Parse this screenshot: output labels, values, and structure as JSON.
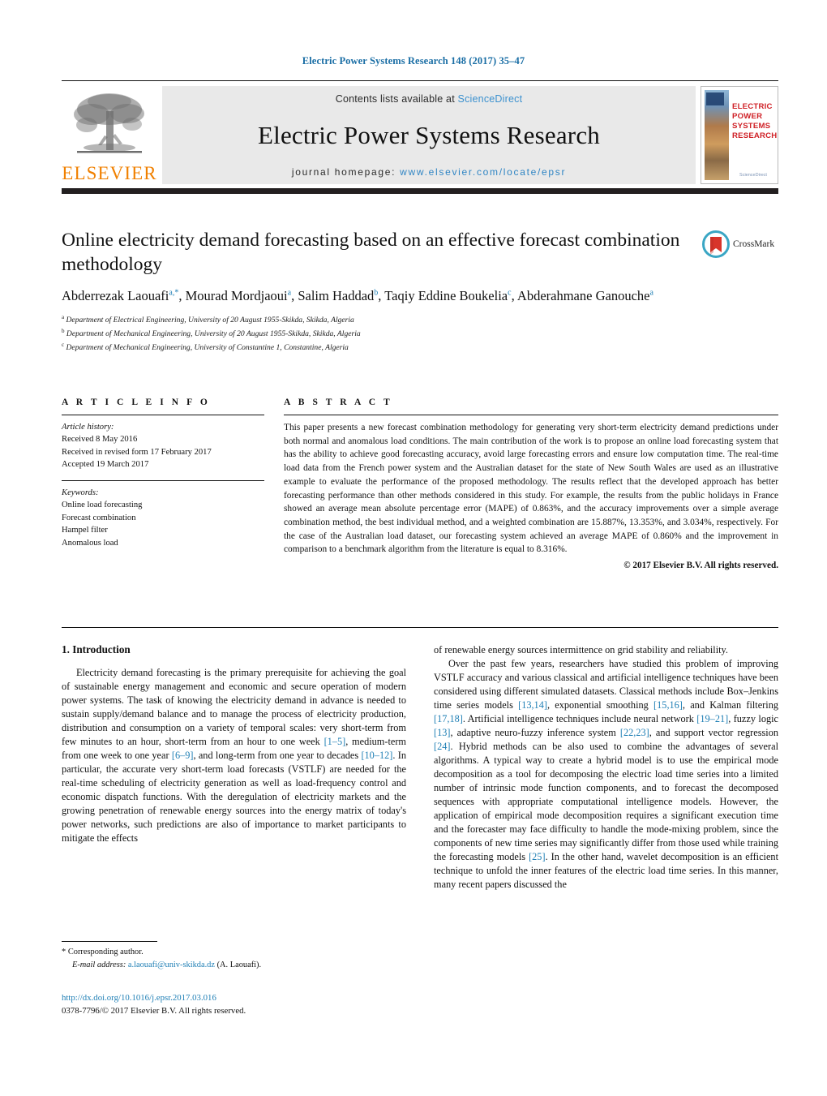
{
  "running_head": "Electric Power Systems Research 148 (2017) 35–47",
  "masthead": {
    "contents_prefix": "Contents lists available at ",
    "sciencedirect": "ScienceDirect",
    "journal_title": "Electric Power Systems Research",
    "homepage_prefix": "journal homepage: ",
    "homepage_url": "www.elsevier.com/locate/epsr",
    "publisher": "ELSEVIER",
    "cover_title": "ELECTRIC POWER SYSTEMS RESEARCH",
    "cover_footer": "ScienceDirect",
    "accent_blue": "#3c91cf",
    "publisher_orange": "#f08000",
    "cover_red": "#cf2026"
  },
  "article": {
    "title": "Online electricity demand forecasting based on an effective forecast combination methodology",
    "authors_html": "Abderrezak Laouafi<sup>a,*</sup>, Mourad Mordjaoui<sup>a</sup>, Salim Haddad<sup>b</sup>, Taqiy Eddine Boukelia<sup>c</sup>, Abderahmane Ganouche<sup>a</sup>",
    "affiliations": [
      "Department of Electrical Engineering, University of 20 August 1955-Skikda, Skikda, Algeria",
      "Department of Mechanical Engineering, University of 20 August 1955-Skikda, Skikda, Algeria",
      "Department of Mechanical Engineering, University of Constantine 1, Constantine, Algeria"
    ],
    "affiliation_marks": [
      "a",
      "b",
      "c"
    ],
    "crossmark_label": "CrossMark"
  },
  "article_info": {
    "heading": "A R T I C L E   I N F O",
    "history_label": "Article history:",
    "history": [
      "Received 8 May 2016",
      "Received in revised form 17 February 2017",
      "Accepted 19 March 2017"
    ],
    "keywords_label": "Keywords:",
    "keywords": [
      "Online load forecasting",
      "Forecast combination",
      "Hampel filter",
      "Anomalous load"
    ]
  },
  "abstract": {
    "heading": "A B S T R A C T",
    "text": "This paper presents a new forecast combination methodology for generating very short-term electricity demand predictions under both normal and anomalous load conditions. The main contribution of the work is to propose an online load forecasting system that has the ability to achieve good forecasting accuracy, avoid large forecasting errors and ensure low computation time. The real-time load data from the French power system and the Australian dataset for the state of New South Wales are used as an illustrative example to evaluate the performance of the proposed methodology. The results reflect that the developed approach has better forecasting performance than other methods considered in this study. For example, the results from the public holidays in France showed an average mean absolute percentage error (MAPE) of 0.863%, and the accuracy improvements over a simple average combination method, the best individual method, and a weighted combination are 15.887%, 13.353%, and 3.034%, respectively. For the case of the Australian load dataset, our forecasting system achieved an average MAPE of 0.860% and the improvement in comparison to a benchmark algorithm from the literature is equal to 8.316%.",
    "copyright": "© 2017 Elsevier B.V. All rights reserved."
  },
  "introduction": {
    "number_title": "1.  Introduction",
    "left_para_1_a": "Electricity demand forecasting is the primary prerequisite for achieving the goal of sustainable energy management and economic and secure operation of modern power systems. The task of knowing the electricity demand in advance is needed to sustain supply/demand balance and to manage the process of electricity production, distribution and consumption on a variety of temporal scales: very short-term from few minutes to an hour, short-term from an hour to one week ",
    "cite_1_5": "[1–5]",
    "left_para_1_b": ", medium-term from one week to one year ",
    "cite_6_9": "[6–9]",
    "left_para_1_c": ", and long-term from one year to decades ",
    "cite_10_12": "[10–12]",
    "left_para_1_d": ". In particular, the accurate very short-term load forecasts (VSTLF) are needed for the real-time scheduling of electricity generation as well as load-frequency control and economic dispatch functions. With the deregulation of electricity markets and the growing penetration of renewable energy sources into the energy matrix of today's power networks, such predictions are also of importance to market participants to mitigate the effects",
    "right_para_1_cont": "of renewable energy sources intermittence on grid stability and reliability.",
    "right_para_2_a": "Over the past few years, researchers have studied this problem of improving VSTLF accuracy and various classical and artificial intelligence techniques have been considered using different simulated datasets. Classical methods include Box–Jenkins time series models ",
    "cite_13_14": "[13,14]",
    "right_para_2_b": ", exponential smoothing ",
    "cite_15_16": "[15,16]",
    "right_para_2_c": ", and Kalman filtering ",
    "cite_17_18": "[17,18]",
    "right_para_2_d": ". Artificial intelligence techniques include neural network ",
    "cite_19_21": "[19–21]",
    "right_para_2_e": ", fuzzy logic ",
    "cite_13": "[13]",
    "right_para_2_f": ", adaptive neuro-fuzzy inference system ",
    "cite_22_23": "[22,23]",
    "right_para_2_g": ", and support vector regression ",
    "cite_24": "[24]",
    "right_para_2_h": ". Hybrid methods can be also used to combine the advantages of several algorithms. A typical way to create a hybrid model is to use the empirical mode decomposition as a tool for decomposing the electric load time series into a limited number of intrinsic mode function components, and to forecast the decomposed sequences with appropriate computational intelligence models. However, the application of empirical mode decomposition requires a significant execution time and the forecaster may face difficulty to handle the mode-mixing problem, since the components of new time series may significantly differ from those used while training the forecasting models ",
    "cite_25": "[25]",
    "right_para_2_i": ". In the other hand, wavelet decomposition is an efficient technique to unfold the inner features of the electric load time series. In this manner, many recent papers discussed the"
  },
  "footer": {
    "corresponding_marker": "*",
    "corresponding_label": "Corresponding author.",
    "email_label": "E-mail address:",
    "email": "a.laouafi@univ-skikda.dz",
    "email_owner": "(A. Laouafi).",
    "doi_url": "http://dx.doi.org/10.1016/j.epsr.2017.03.016",
    "issn_line": "0378-7796/© 2017 Elsevier B.V. All rights reserved."
  }
}
